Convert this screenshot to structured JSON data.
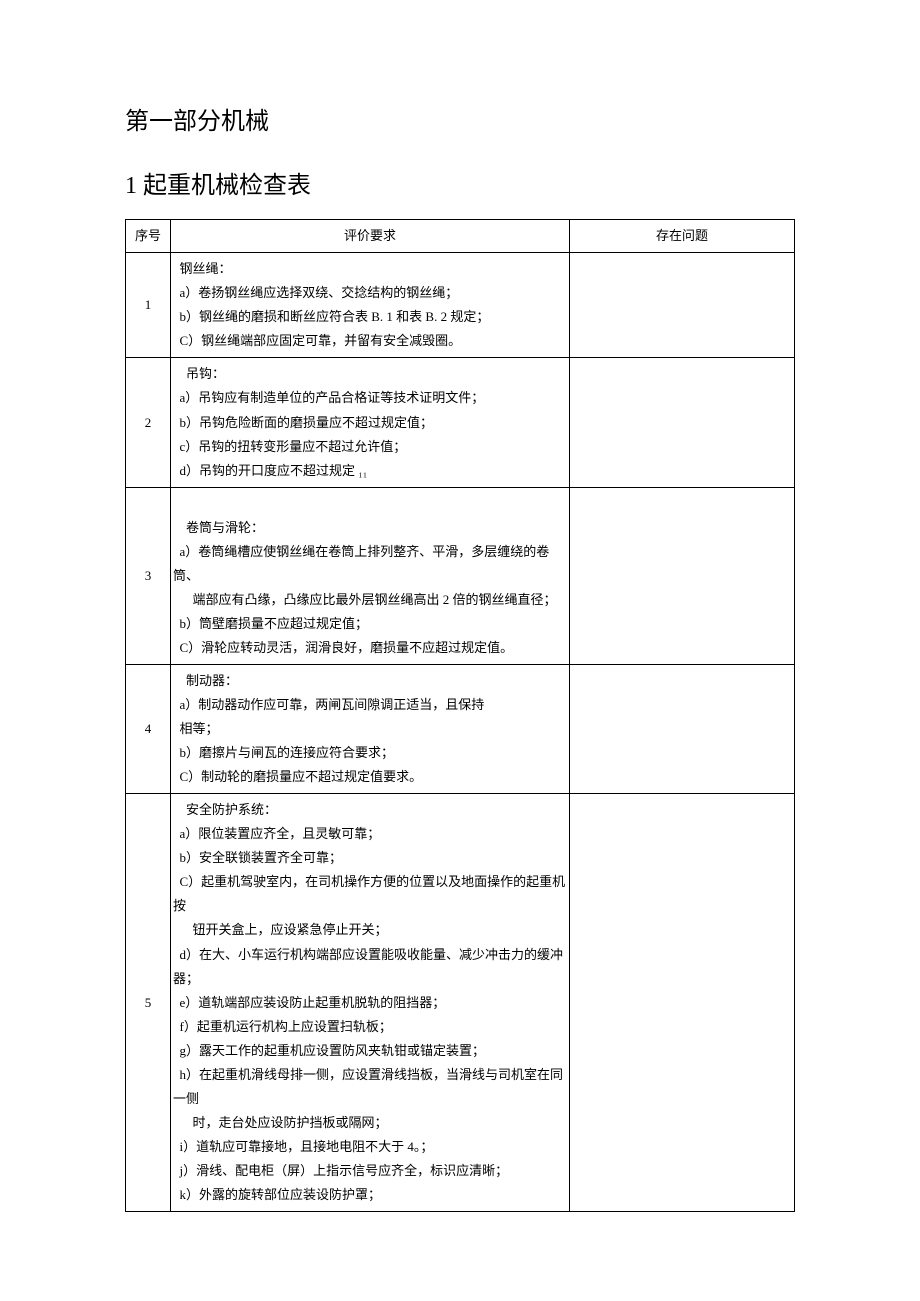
{
  "headings": {
    "part": "第一部分机械",
    "section": "1 起重机械检查表"
  },
  "table": {
    "headers": {
      "seq": "序号",
      "req": "评价要求",
      "issue": "存在问题"
    },
    "rows": [
      {
        "seq": "1",
        "req": "  钢丝绳：\n  a）卷扬钢丝绳应选择双绕、交捻结构的钢丝绳；\n  b）钢丝绳的磨损和断丝应符合表 B. 1 和表 B. 2 规定；\n  C）钢丝绳端部应固定可靠，并留有安全减毁圈。",
        "issue": ""
      },
      {
        "seq": "2",
        "req": "    吊钩：\n  a）吊钩应有制造单位的产品合格证等技术证明文件；\n  b）吊钩危险断面的磨损量应不超过规定值；\n  c）吊钩的扭转变形量应不超过允许值；\n  d）吊钩的开口度应不超过规定 ₁₁",
        "issue": ""
      },
      {
        "seq": "3",
        "req": "\n    卷筒与滑轮：\n  a）卷筒绳槽应使钢丝绳在卷筒上排列整齐、平滑，多层缠绕的卷筒、\n      端部应有凸缘，凸缘应比最外层钢丝绳高出 2 倍的钢丝绳直径；\n  b）筒壁磨损量不应超过规定值；\n  C）滑轮应转动灵活，润滑良好，磨损量不应超过规定值。",
        "issue": ""
      },
      {
        "seq": "4",
        "req": "    制动器：\n  a）制动器动作应可靠，两闸瓦间隙调正适当，且保持\n  相等；\n  b）磨擦片与闸瓦的连接应符合要求；\n  C）制动轮的磨损量应不超过规定值要求。",
        "issue": ""
      },
      {
        "seq": "5",
        "req": "    安全防护系统：\n  a）限位装置应齐全，且灵敏可靠；\n  b）安全联锁装置齐全可靠；\n  C）起重机驾驶室内，在司机操作方便的位置以及地面操作的起重机按\n      钮开关盒上，应设紧急停止开关；\n  d）在大、小车运行机构端部应设置能吸收能量、减少冲击力的缓冲器；\n  e）道轨端部应装设防止起重机脱轨的阻挡器；\n  f）起重机运行机构上应设置扫轨板；\n  g）露天工作的起重机应设置防风夹轨钳或锚定装置；\n  h）在起重机滑线母排一侧，应设置滑线挡板，当滑线与司机室在同一侧\n      时，走台处应设防护挡板或隔网；\n  i）道轨应可靠接地，且接地电阻不大于 4。；\n  j）滑线、配电柜（屏）上指示信号应齐全，标识应清晰；\n  k）外露的旋转部位应装设防护罩；",
        "issue": ""
      }
    ]
  }
}
